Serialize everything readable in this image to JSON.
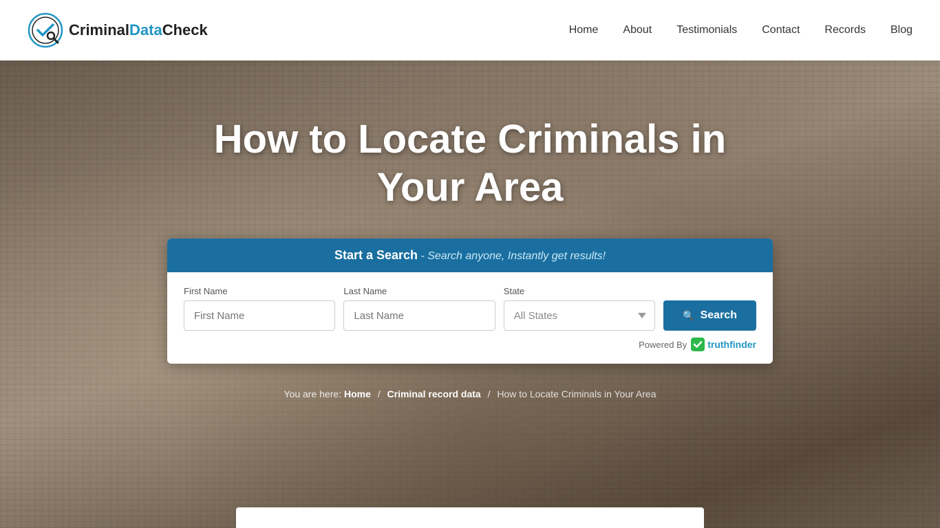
{
  "header": {
    "logo_criminal": "Criminal",
    "logo_data": "Data",
    "logo_check": "Check",
    "nav": {
      "home": "Home",
      "about": "About",
      "testimonials": "Testimonials",
      "contact": "Contact",
      "records": "Records",
      "blog": "Blog"
    }
  },
  "hero": {
    "title": "How to Locate Criminals in Your Area",
    "search_widget": {
      "header_start": "Start a Search",
      "header_subtitle": "- Search anyone, Instantly get results!",
      "first_name_label": "First Name",
      "first_name_placeholder": "First Name",
      "last_name_label": "Last Name",
      "last_name_placeholder": "Last Name",
      "state_label": "State",
      "state_default": "All States",
      "search_button": "Search",
      "powered_by_text": "Powered By",
      "truthfinder_label": "truthfinder"
    },
    "breadcrumb": {
      "prefix": "You are here: ",
      "home": "Home",
      "sep1": "/",
      "section": "Criminal record data",
      "sep2": "/",
      "current": "How to Locate Criminals in Your Area"
    }
  }
}
